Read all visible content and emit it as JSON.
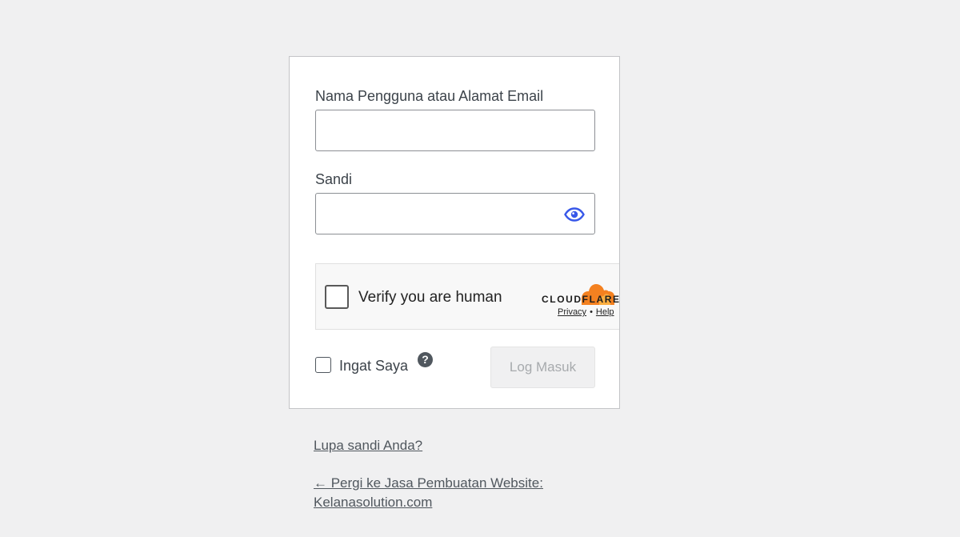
{
  "login_form": {
    "username_label": "Nama Pengguna atau Alamat Email",
    "username_value": "",
    "password_label": "Sandi",
    "password_value": "",
    "show_password_icon": "eye-icon",
    "remember_label": "Ingat Saya",
    "remember_checked": false,
    "help_icon": "question-circle-icon",
    "help_glyph": "?",
    "submit_label": "Log Masuk",
    "submit_enabled": false
  },
  "captcha": {
    "label": "Verify you are human",
    "brand": "CLOUDFLARE",
    "privacy_link": "Privacy",
    "separator": "•",
    "help_link": "Help",
    "brand_color": "#f48120"
  },
  "links": {
    "lost_password": "Lupa sandi Anda?",
    "back_to_site_line1": "← Pergi ke Jasa Pembuatan Website:",
    "back_to_site_line2": "Kelanasolution.com"
  },
  "colors": {
    "background": "#f0f0f1",
    "accent": "#3858e9",
    "text": "#3c434a"
  }
}
